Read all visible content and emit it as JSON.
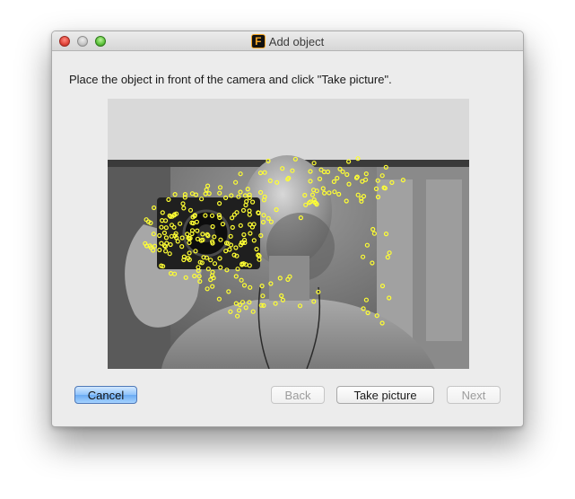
{
  "window": {
    "title": "Add object",
    "app_icon_letter": "F",
    "app_icon_name": "app-icon"
  },
  "instructions": "Place the object in front of the camera and click \"Take picture\".",
  "camera": {
    "feature_color": "#ffff33"
  },
  "buttons": {
    "cancel": "Cancel",
    "back": "Back",
    "take_picture": "Take picture",
    "next": "Next"
  }
}
